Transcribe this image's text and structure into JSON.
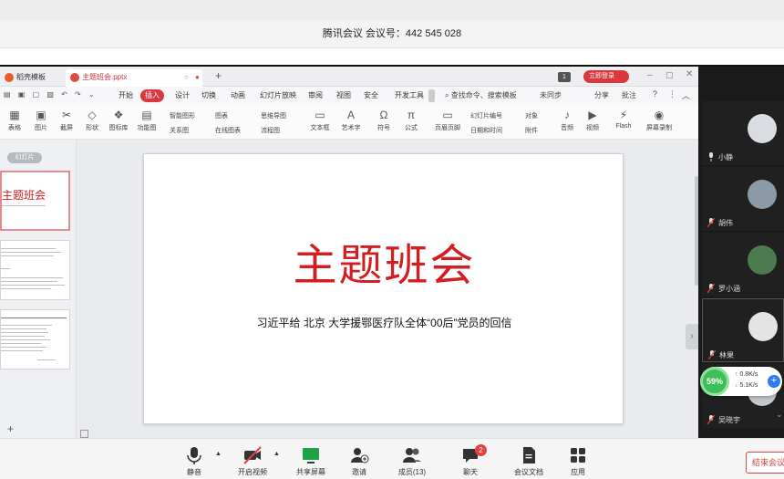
{
  "meeting": {
    "title": "腾讯会议 会议号：442 545 028"
  },
  "wps": {
    "tabs": [
      {
        "label": "稻壳模板"
      },
      {
        "label": "主题班会.pptx"
      }
    ],
    "add_tab": "+",
    "login_label": "立即登录",
    "menu": [
      "开始",
      "插入",
      "设计",
      "切换",
      "动画",
      "幻灯片放映",
      "审阅",
      "视图",
      "安全",
      "开发工具"
    ],
    "menu_active": "插入",
    "search_label": "查找命令、搜索模板",
    "right_menu": [
      "未同步",
      "分享",
      "批注"
    ],
    "ribbon_big": [
      {
        "label": "表格",
        "glyph": "▦"
      },
      {
        "label": "图片",
        "glyph": "▣"
      },
      {
        "label": "截屏",
        "glyph": "✂"
      },
      {
        "label": "形状",
        "glyph": "◇"
      },
      {
        "label": "图标库",
        "glyph": "❖"
      },
      {
        "label": "功能图",
        "glyph": "▤"
      }
    ],
    "ribbon_small": [
      "智能图形",
      "图表",
      "关系图",
      "在线图表",
      "思维导图",
      "流程图"
    ],
    "ribbon_right": [
      {
        "label": "文本框",
        "glyph": "A"
      },
      {
        "label": "艺术字",
        "glyph": "A"
      },
      {
        "label": "符号",
        "glyph": "Ω"
      },
      {
        "label": "公式",
        "glyph": "π"
      },
      {
        "label": "页眉页脚",
        "glyph": "▭"
      }
    ],
    "ribbon_small2": [
      "幻灯片编号",
      "对象",
      "日期和时间",
      "附件"
    ],
    "ribbon_media": [
      {
        "label": "音频",
        "glyph": "♪"
      },
      {
        "label": "视频",
        "glyph": "▶"
      },
      {
        "label": "Flash",
        "glyph": "⚡"
      },
      {
        "label": "屏幕录制",
        "glyph": "◉"
      }
    ],
    "panel_tag": "幻灯片",
    "slide": {
      "title": "主题班会",
      "subtitle": "习近平给 北京 大学援鄂医疗队全体“00后”党员的回信"
    },
    "thumb1_text": "主题班会"
  },
  "participants": [
    {
      "name": "小静"
    },
    {
      "name": "胡伟"
    },
    {
      "name": "罗小涵"
    },
    {
      "name": "林果"
    },
    {
      "name": "吴晓宇"
    }
  ],
  "network": {
    "percent": "59%",
    "up": "0.8K/s",
    "down": "5.1K/s"
  },
  "toolbar": [
    {
      "label": "静音",
      "icon": "mic-icon"
    },
    {
      "label": "开启视频",
      "icon": "camera-off-icon"
    },
    {
      "label": "共享屏幕",
      "icon": "share-screen-icon"
    },
    {
      "label": "邀请",
      "icon": "invite-icon"
    },
    {
      "label": "成员(13)",
      "icon": "members-icon"
    },
    {
      "label": "聊天",
      "icon": "chat-icon",
      "badge": "2"
    },
    {
      "label": "会议文档",
      "icon": "doc-icon"
    },
    {
      "label": "应用",
      "icon": "apps-icon"
    }
  ],
  "end_label": "结束会议",
  "colors": {
    "accent_red": "#d21e20",
    "wps_red": "#d9383e",
    "network_green": "#3cbf54"
  }
}
